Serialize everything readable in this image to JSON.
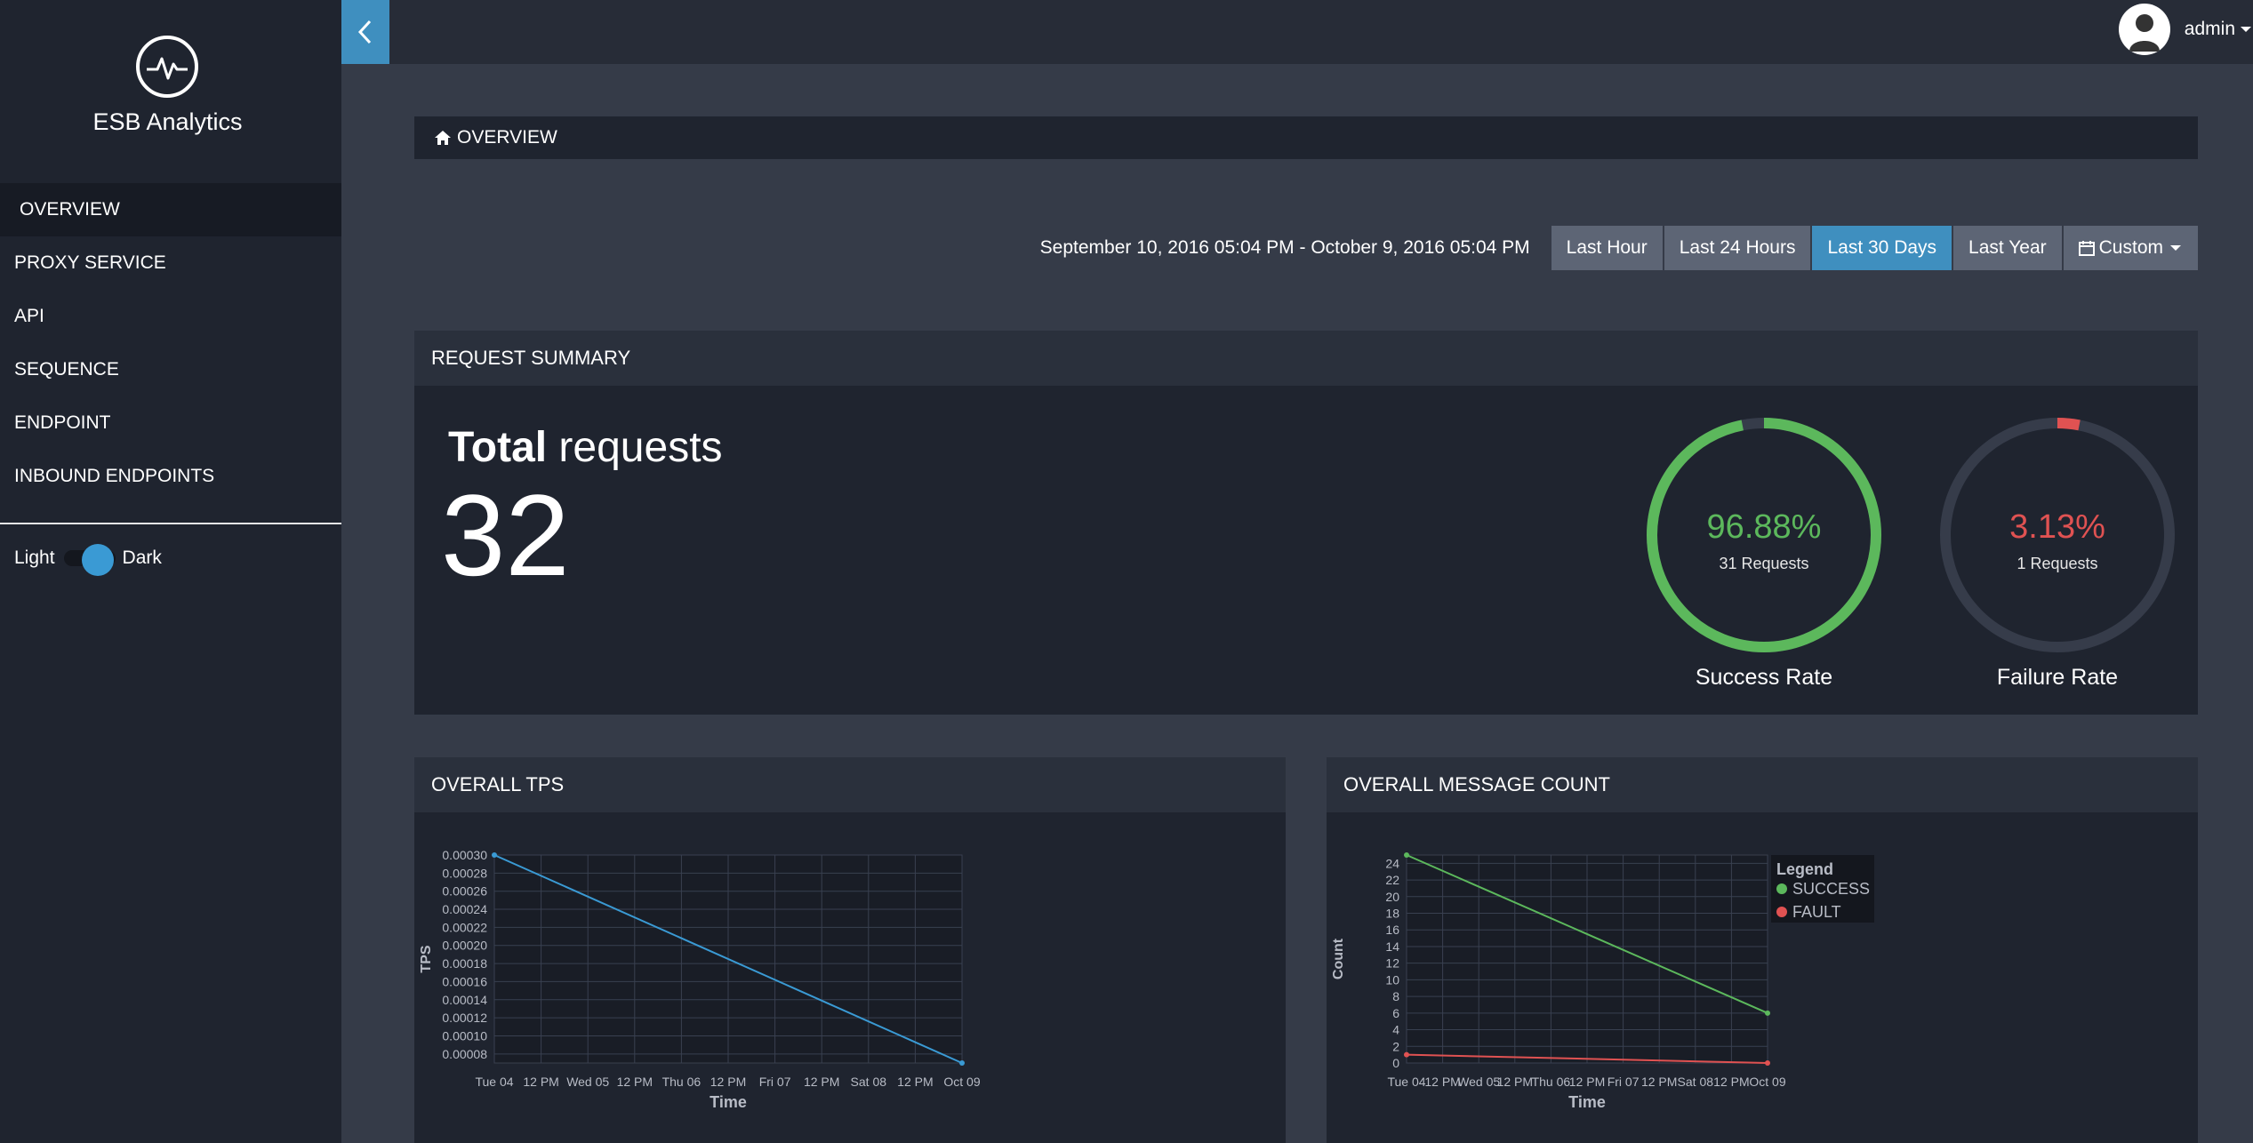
{
  "sidebar": {
    "app_title": "ESB Analytics",
    "logo_icon": "pulse-icon",
    "items": [
      {
        "label": "OVERVIEW",
        "active": true
      },
      {
        "label": "PROXY SERVICE",
        "active": false
      },
      {
        "label": "API",
        "active": false
      },
      {
        "label": "SEQUENCE",
        "active": false
      },
      {
        "label": "ENDPOINT",
        "active": false
      },
      {
        "label": "INBOUND ENDPOINTS",
        "active": false
      }
    ],
    "theme": {
      "light_label": "Light",
      "dark_label": "Dark",
      "selected": "Dark"
    }
  },
  "topbar": {
    "collapse_icon": "chevron-left-icon",
    "user": "admin"
  },
  "breadcrumb": {
    "label": "OVERVIEW",
    "icon": "home-icon"
  },
  "date_range": {
    "text": "September 10, 2016 05:04 PM - October 9, 2016 05:04 PM",
    "buttons": [
      "Last Hour",
      "Last 24 Hours",
      "Last 30 Days",
      "Last Year",
      "Custom"
    ],
    "selected": "Last 30 Days"
  },
  "summary": {
    "title": "REQUEST SUMMARY",
    "total_bold": "Total",
    "total_rest": " requests",
    "total_value": "32",
    "success": {
      "percent": "96.88%",
      "requests": "31 Requests",
      "label": "Success Rate",
      "fraction": 0.9688,
      "color": "#5cb85c"
    },
    "failure": {
      "percent": "3.13%",
      "requests": "1 Requests",
      "label": "Failure Rate",
      "fraction": 0.0313,
      "color": "#e05252"
    }
  },
  "colors": {
    "accent": "#3f8fbf",
    "success": "#5cb85c",
    "fault": "#e05252",
    "tps_line": "#3a9ad4"
  },
  "chart_data": [
    {
      "type": "line",
      "title": "OVERALL TPS",
      "xlabel": "Time",
      "ylabel": "TPS",
      "x_ticks": [
        "Tue 04",
        "12 PM",
        "Wed 05",
        "12 PM",
        "Thu 06",
        "12 PM",
        "Fri 07",
        "12 PM",
        "Sat 08",
        "12 PM",
        "Oct 09"
      ],
      "y_ticks": [
        "0.00030",
        "0.00028",
        "0.00026",
        "0.00024",
        "0.00022",
        "0.00020",
        "0.00018",
        "0.00016",
        "0.00014",
        "0.00012",
        "0.00010",
        "0.00008"
      ],
      "ylim": [
        7e-05,
        0.0003
      ],
      "grid": true,
      "series": [
        {
          "x": [
            0,
            10
          ],
          "values": [
            0.0003,
            7e-05
          ]
        }
      ]
    },
    {
      "type": "line",
      "title": "OVERALL MESSAGE COUNT",
      "xlabel": "Time",
      "ylabel": "Count",
      "x_ticks": [
        "Tue 04",
        "12 PM",
        "Wed 05",
        "12 PM",
        "Thu 06",
        "12 PM",
        "Fri 07",
        "12 PM",
        "Sat 08",
        "12 PM",
        "Oct 09"
      ],
      "y_ticks": [
        "24",
        "22",
        "20",
        "18",
        "16",
        "14",
        "12",
        "10",
        "8",
        "6",
        "4",
        "2",
        "0"
      ],
      "ylim": [
        0,
        25
      ],
      "grid": true,
      "legend_title": "Legend",
      "legend_position": "top-right",
      "series": [
        {
          "name": "SUCCESS",
          "x": [
            0,
            10
          ],
          "values": [
            25,
            6
          ],
          "color": "#5cb85c"
        },
        {
          "name": "FAULT",
          "x": [
            0,
            10
          ],
          "values": [
            1,
            0
          ],
          "color": "#e05252"
        }
      ]
    }
  ]
}
